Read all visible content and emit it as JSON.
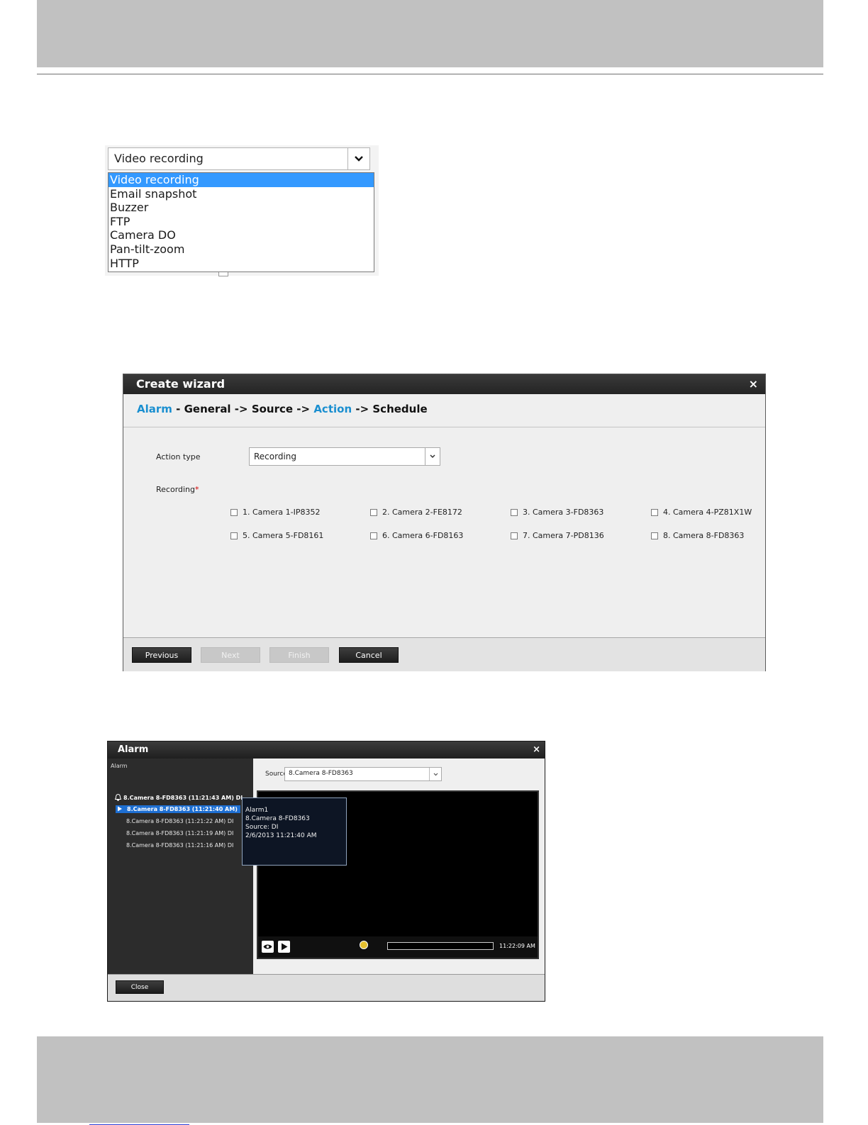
{
  "dropdown": {
    "selected_value": "Video recording",
    "options": [
      "Video recording",
      "Email snapshot",
      "Buzzer",
      "FTP",
      "Camera DO",
      "Pan-tilt-zoom",
      "HTTP"
    ]
  },
  "wizard": {
    "title": "Create wizard",
    "close": "×",
    "steps": {
      "alarm": "Alarm",
      "dash": " - ",
      "general": "General",
      "arrow": " -> ",
      "source": "Source",
      "action": "Action",
      "schedule": "Schedule"
    },
    "action_type_label": "Action type",
    "action_type_value": "Recording",
    "recording_label": "Recording",
    "required_mark": "*",
    "cameras": [
      "1. Camera 1-IP8352",
      "2. Camera 2-FE8172",
      "3. Camera 3-FD8363",
      "4. Camera 4-PZ81X1W",
      "5. Camera 5-FD8161",
      "6. Camera 6-FD8163",
      "7. Camera 7-PD8136",
      "8. Camera 8-FD8363"
    ],
    "buttons": {
      "previous": "Previous",
      "next": "Next",
      "finish": "Finish",
      "cancel": "Cancel"
    }
  },
  "alarm_window": {
    "title": "Alarm",
    "close": "×",
    "list_header": "Alarm",
    "items": [
      "8.Camera 8-FD8363 (11:21:43 AM) DI",
      "8.Camera 8-FD8363 (11:21:40 AM)",
      "8.Camera 8-FD8363 (11:21:22 AM) DI",
      "8.Camera 8-FD8363 (11:21:19 AM) DI",
      "8.Camera 8-FD8363 (11:21:16 AM) DI"
    ],
    "source_label": "Source",
    "source_value": "8.Camera 8-FD8363",
    "tooltip": [
      "Alarm1",
      "8.Camera 8-FD8363",
      "Source: DI",
      "2/6/2013 11:21:40 AM"
    ],
    "time": "11:22:09 AM",
    "close_button": "Close"
  }
}
